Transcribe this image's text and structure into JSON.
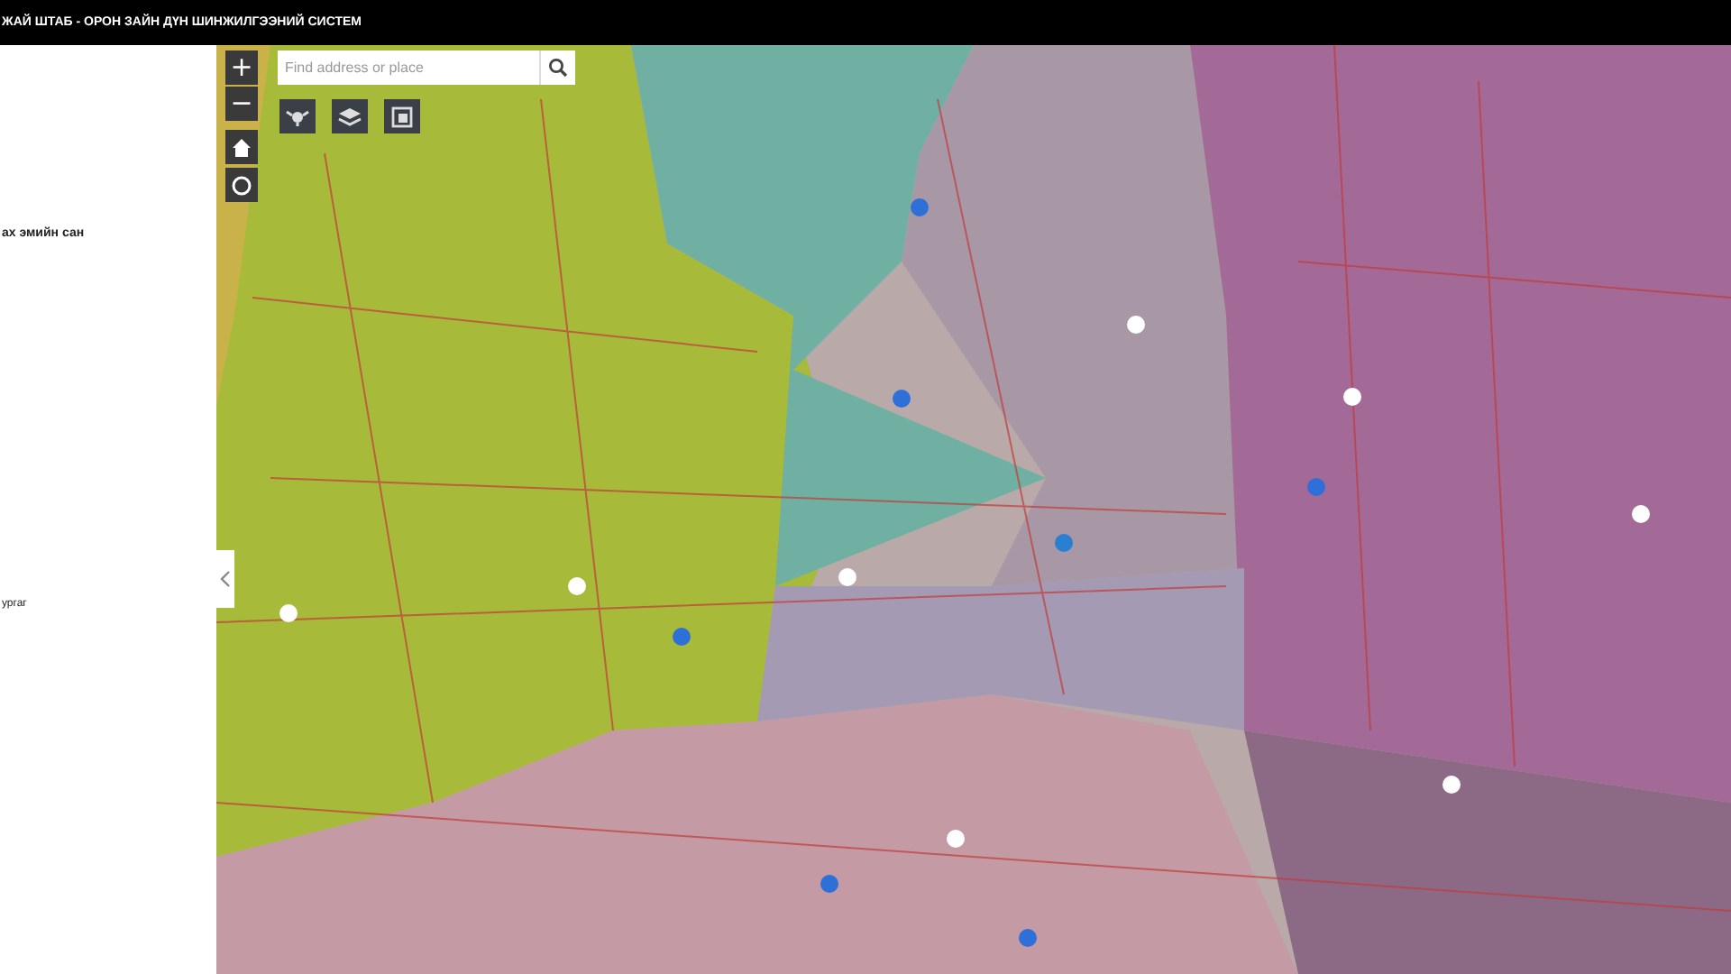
{
  "header": {
    "title": "ЖАЙ ШТАБ - ОРОН ЗАЙН ДҮН ШИНЖИЛГЭЭНИЙ СИСТЕМ"
  },
  "sidebar": {
    "items": [
      {
        "label": "ах эмийн сан"
      },
      {
        "label": "ургаг"
      }
    ]
  },
  "map": {
    "search": {
      "placeholder": "Find address or place"
    },
    "zoom_in": "+",
    "zoom_out": "−"
  }
}
